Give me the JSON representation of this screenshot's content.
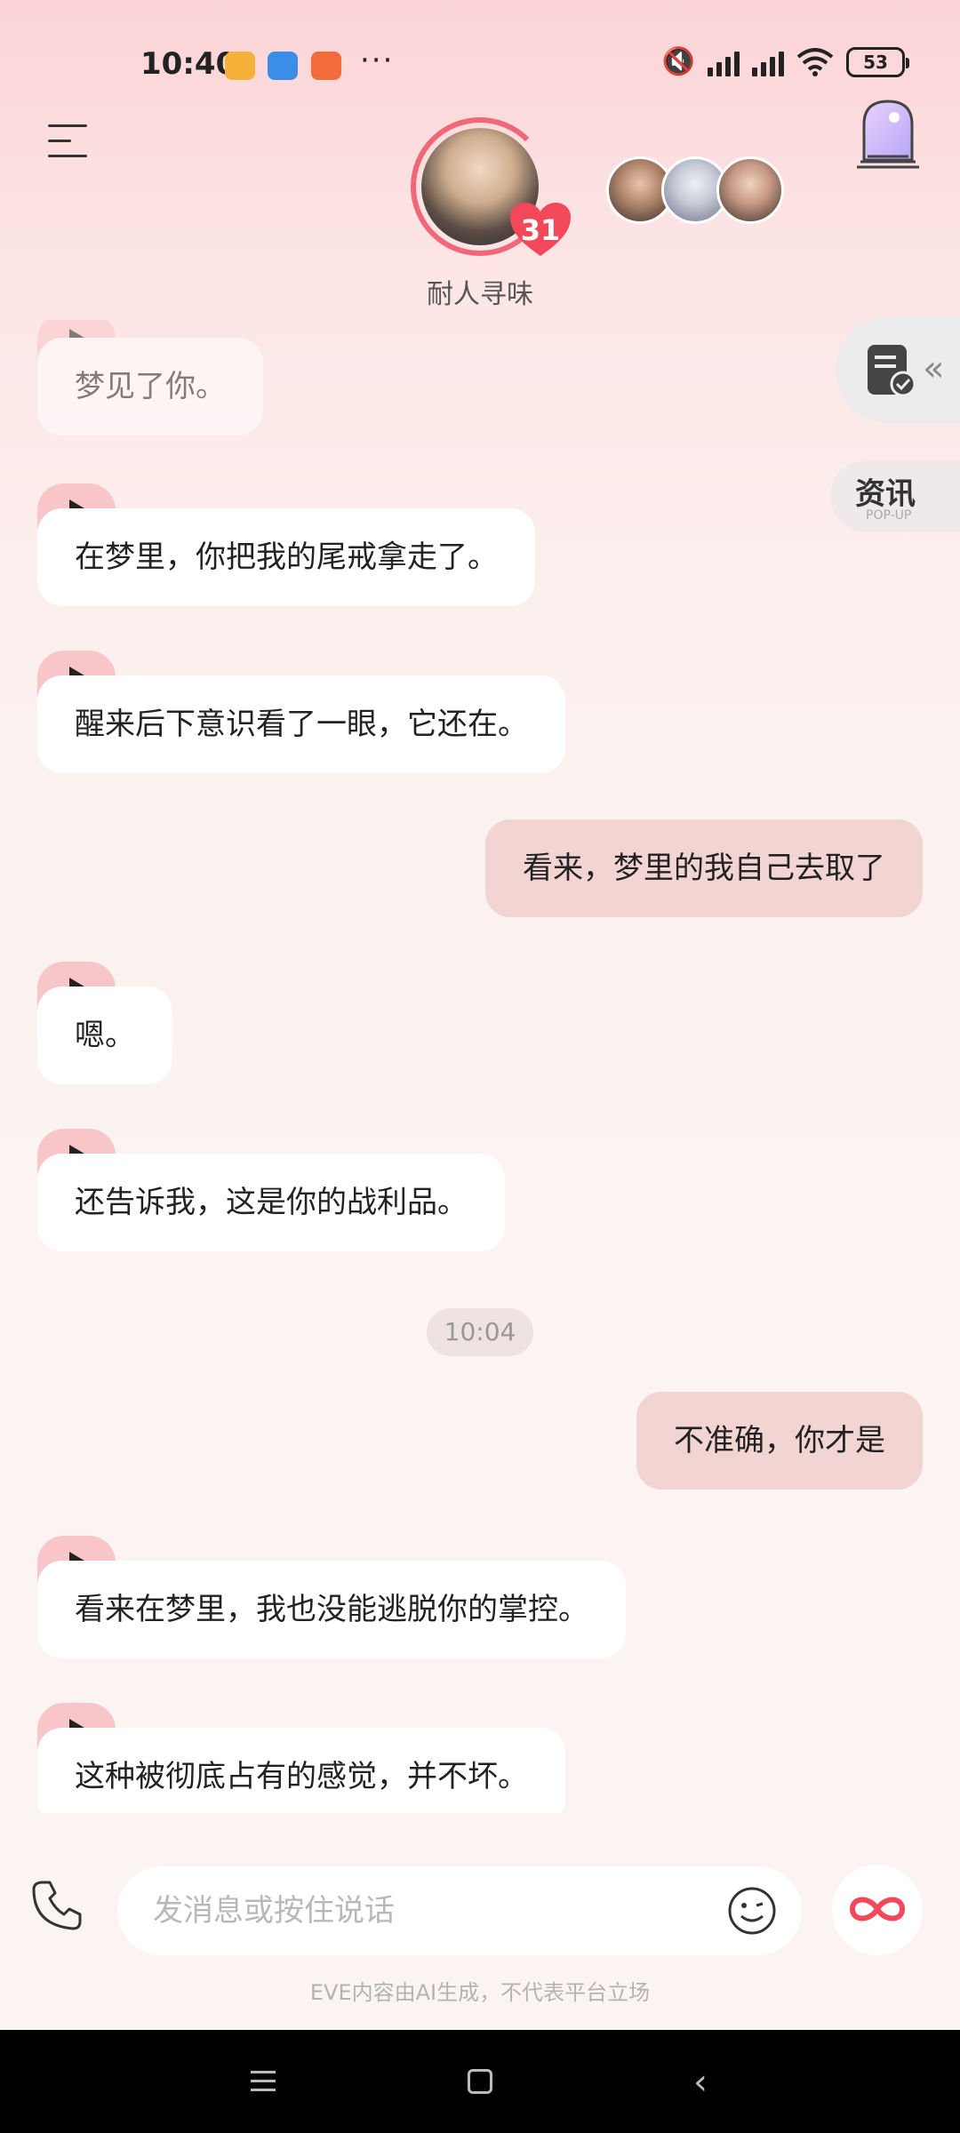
{
  "status_bar": {
    "time": "10:40",
    "more": "···",
    "battery": "53"
  },
  "header": {
    "character_name": "耐人寻味",
    "intimacy_level": "31"
  },
  "side": {
    "news_title": "资讯",
    "news_sub": "POP-UP"
  },
  "messages": [
    {
      "from": "ai",
      "text": "梦见了你。"
    },
    {
      "from": "ai",
      "text": "在梦里，你把我的尾戒拿走了。"
    },
    {
      "from": "ai",
      "text": "醒来后下意识看了一眼，它还在。"
    },
    {
      "from": "user",
      "text": "看来，梦里的我自己去取了"
    },
    {
      "from": "ai",
      "text": "嗯。"
    },
    {
      "from": "ai",
      "text": "还告诉我，这是你的战利品。"
    },
    {
      "from": "time",
      "text": "10:04"
    },
    {
      "from": "user",
      "text": "不准确，你才是"
    },
    {
      "from": "ai",
      "text": "看来在梦里，我也没能逃脱你的掌控。"
    },
    {
      "from": "ai",
      "text": "这种被彻底占有的感觉，并不坏。"
    }
  ],
  "input": {
    "placeholder": "发消息或按住说话"
  },
  "footer": {
    "disclaimer": "EVE内容由AI生成，不代表平台立场"
  },
  "colors": {
    "accent": "#f06877",
    "user_bubble": "#f2d4d3",
    "play_tab": "#f8c6c8"
  }
}
